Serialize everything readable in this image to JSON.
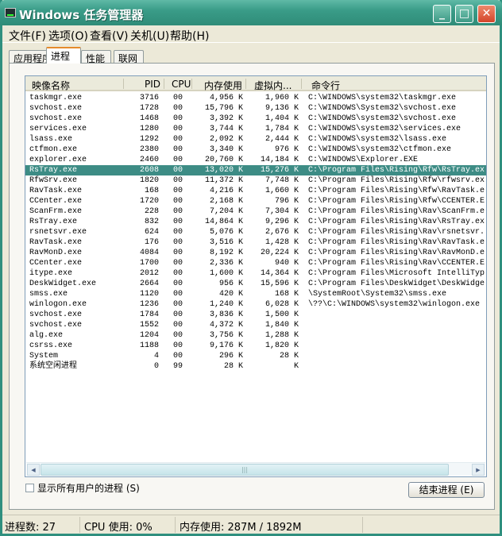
{
  "window": {
    "title": "Windows 任务管理器",
    "minimize": "_",
    "maximize": "□",
    "close": "✕"
  },
  "menu": [
    "文件(F)",
    "选项(O)",
    "查看(V)",
    "关机(U)",
    "帮助(H)"
  ],
  "tabs": [
    {
      "label": "应用程序"
    },
    {
      "label": "进程",
      "active": true
    },
    {
      "label": "性能"
    },
    {
      "label": "联网"
    }
  ],
  "columns": [
    "映像名称",
    "PID",
    "CPU",
    "内存使用",
    "虚拟内...",
    "命令行"
  ],
  "selected_row": 7,
  "colors": {
    "selection": "#3d8c85",
    "titlebar": "#3a9c88"
  },
  "rows": [
    [
      "taskmgr.exe",
      "3716",
      "00",
      "4,956 K",
      "1,960 K",
      "C:\\WINDOWS\\system32\\taskmgr.exe"
    ],
    [
      "svchost.exe",
      "1728",
      "00",
      "15,796 K",
      "9,136 K",
      "C:\\WINDOWS\\System32\\svchost.exe"
    ],
    [
      "svchost.exe",
      "1468",
      "00",
      "3,392 K",
      "1,404 K",
      "C:\\WINDOWS\\system32\\svchost.exe"
    ],
    [
      "services.exe",
      "1280",
      "00",
      "3,744 K",
      "1,784 K",
      "C:\\WINDOWS\\system32\\services.exe"
    ],
    [
      "lsass.exe",
      "1292",
      "00",
      "2,092 K",
      "2,444 K",
      "C:\\WINDOWS\\system32\\lsass.exe"
    ],
    [
      "ctfmon.exe",
      "2380",
      "00",
      "3,340 K",
      "976 K",
      "C:\\WINDOWS\\system32\\ctfmon.exe"
    ],
    [
      "explorer.exe",
      "2460",
      "00",
      "20,760 K",
      "14,184 K",
      "C:\\WINDOWS\\Explorer.EXE"
    ],
    [
      "RsTray.exe",
      "2608",
      "00",
      "13,020 K",
      "15,276 K",
      "C:\\Program Files\\Rising\\Rfw\\RsTray.ex"
    ],
    [
      "RfwSrv.exe",
      "1820",
      "00",
      "11,372 K",
      "7,748 K",
      "C:\\Program Files\\Rising\\Rfw\\rfwsrv.ex"
    ],
    [
      "RavTask.exe",
      "168",
      "00",
      "4,216 K",
      "1,660 K",
      "C:\\Program Files\\Rising\\Rfw\\RavTask.e"
    ],
    [
      "CCenter.exe",
      "1720",
      "00",
      "2,168 K",
      "796 K",
      "C:\\Program Files\\Rising\\Rfw\\CCENTER.E"
    ],
    [
      "ScanFrm.exe",
      "228",
      "00",
      "7,204 K",
      "7,304 K",
      "C:\\Program Files\\Rising\\Rav\\ScanFrm.e"
    ],
    [
      "RsTray.exe",
      "832",
      "00",
      "14,864 K",
      "9,296 K",
      "C:\\Program Files\\Rising\\Rav\\RsTray.ex"
    ],
    [
      "rsnetsvr.exe",
      "624",
      "00",
      "5,076 K",
      "2,676 K",
      "C:\\Program Files\\Rising\\Rav\\rsnetsvr."
    ],
    [
      "RavTask.exe",
      "176",
      "00",
      "3,516 K",
      "1,428 K",
      "C:\\Program Files\\Rising\\Rav\\RavTask.e"
    ],
    [
      "RavMonD.exe",
      "4084",
      "00",
      "8,192 K",
      "20,224 K",
      "C:\\Program Files\\Rising\\Rav\\RavMonD.e"
    ],
    [
      "CCenter.exe",
      "1700",
      "00",
      "2,336 K",
      "940 K",
      "C:\\Program Files\\Rising\\Rav\\CCENTER.E"
    ],
    [
      "itype.exe",
      "2012",
      "00",
      "1,600 K",
      "14,364 K",
      "C:\\Program Files\\Microsoft IntelliTyp"
    ],
    [
      "DeskWidget.exe",
      "2664",
      "00",
      "956 K",
      "15,596 K",
      "C:\\Program Files\\DeskWidget\\DeskWidge"
    ],
    [
      "smss.exe",
      "1120",
      "00",
      "420 K",
      "168 K",
      "\\SystemRoot\\System32\\smss.exe"
    ],
    [
      "winlogon.exe",
      "1236",
      "00",
      "1,240 K",
      "6,028 K",
      "\\??\\C:\\WINDOWS\\system32\\winlogon.exe"
    ],
    [
      "svchost.exe",
      "1784",
      "00",
      "3,836 K",
      "1,500 K",
      ""
    ],
    [
      "svchost.exe",
      "1552",
      "00",
      "4,372 K",
      "1,840 K",
      ""
    ],
    [
      "alg.exe",
      "1204",
      "00",
      "3,756 K",
      "1,288 K",
      ""
    ],
    [
      "csrss.exe",
      "1188",
      "00",
      "9,176 K",
      "1,820 K",
      ""
    ],
    [
      "System",
      "4",
      "00",
      "296 K",
      "28 K",
      ""
    ],
    [
      "系统空闲进程",
      "0",
      "99",
      "28 K",
      "K",
      ""
    ]
  ],
  "show_all_users": {
    "label": "显示所有用户的进程 (S)",
    "checked": false
  },
  "end_process": "结束进程 (E)",
  "status": {
    "processes": "进程数: 27",
    "cpu": "CPU 使用: 0%",
    "memory": "内存使用: 287M / 1892M"
  }
}
